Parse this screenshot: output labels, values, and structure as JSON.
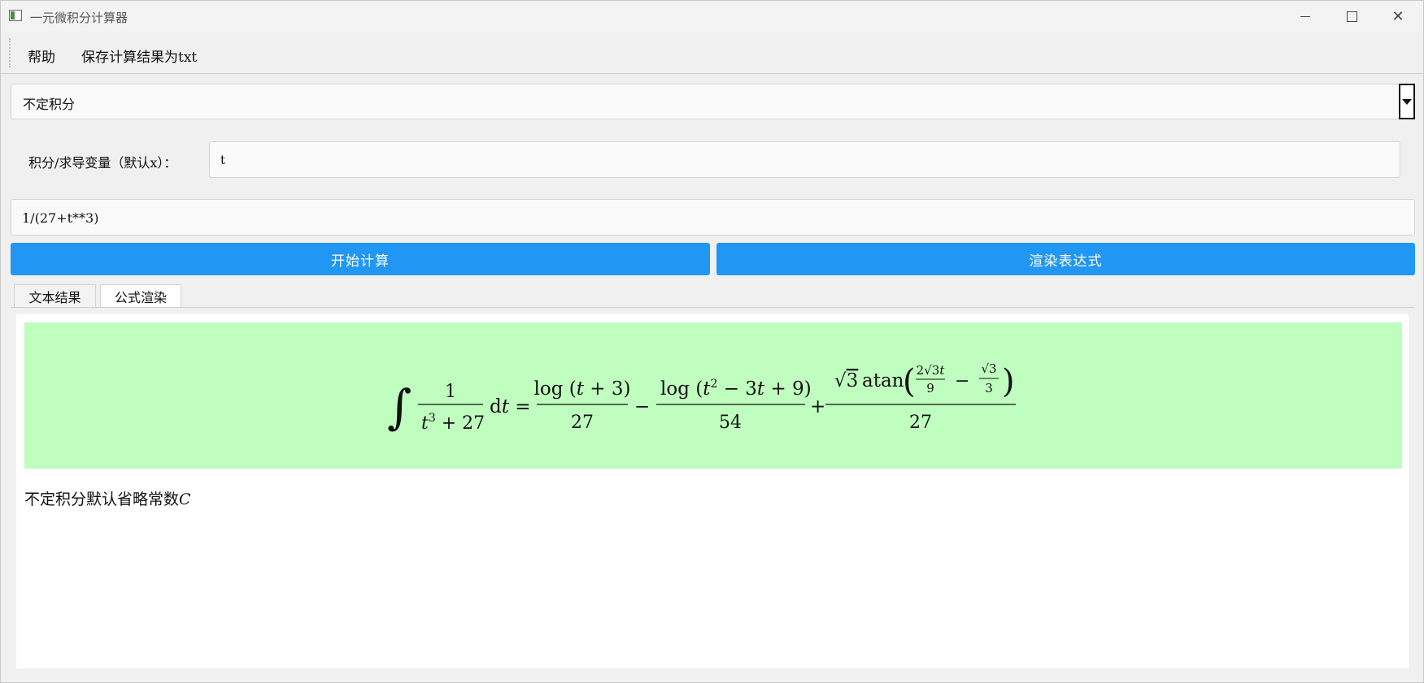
{
  "window": {
    "title": "一元微积分计算器",
    "minimize_icon": "minimize-icon",
    "maximize_icon": "maximize-icon",
    "close_icon": "close-icon"
  },
  "menu": {
    "help": "帮助",
    "save": "保存计算结果为txt"
  },
  "mode_select": {
    "value": "不定积分"
  },
  "variable": {
    "label": "积分/求导变量（默认x）：",
    "value": "t"
  },
  "expression": {
    "value": "1/(27+t**3)"
  },
  "buttons": {
    "calculate": "开始计算",
    "render": "渲染表达式"
  },
  "tabs": [
    {
      "label": "文本结果"
    },
    {
      "label": "公式渲染"
    }
  ],
  "result": {
    "formula": "∫ 1/(t³+27) dt = log(t+3)/27 − log(t²−3t+9)/54 + √3 atan(2√3t/9 − √3/3)/27",
    "note": "不定积分默认省略常数",
    "note_symbol": "C",
    "background": "#c0fec0"
  },
  "colors": {
    "accent": "#2196f3"
  }
}
